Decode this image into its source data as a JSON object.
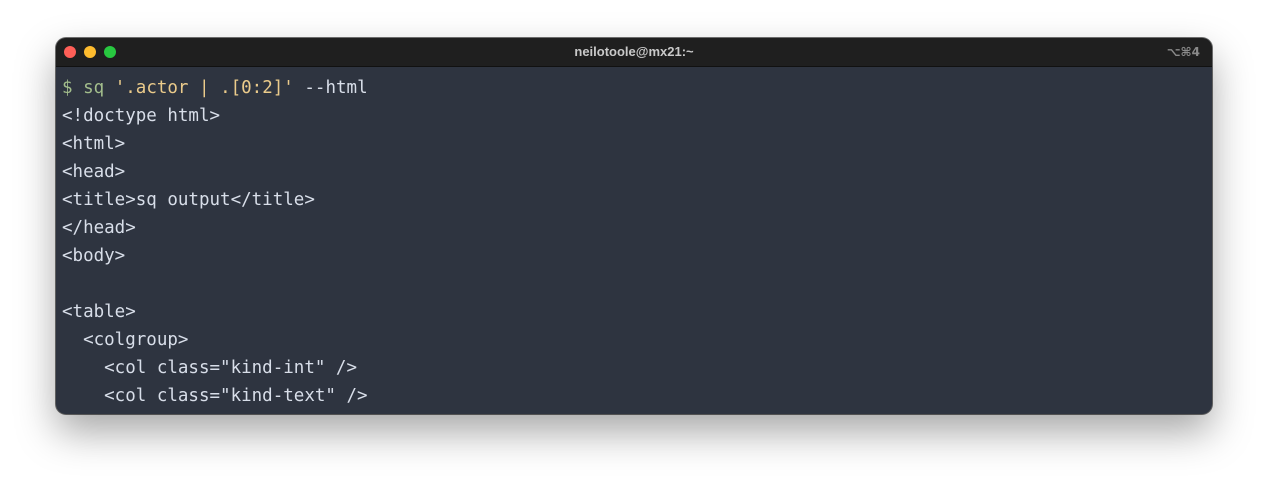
{
  "window": {
    "title": "neilotoole@mx21:~",
    "shortcut": "⌥⌘4"
  },
  "terminal": {
    "prompt": "$",
    "command": "sq",
    "argument": "'.actor | .[0:2]'",
    "flag": "--html",
    "output_lines": [
      "<!doctype html>",
      "<html>",
      "<head>",
      "<title>sq output</title>",
      "</head>",
      "<body>",
      "",
      "<table>",
      "  <colgroup>",
      "    <col class=\"kind-int\" />",
      "    <col class=\"kind-text\" />"
    ]
  },
  "colors": {
    "background": "#2e3440",
    "titlebar": "#1f1f1f",
    "prompt": "#a3be8c",
    "string": "#ebcb8b",
    "foreground": "#d8dee9"
  }
}
